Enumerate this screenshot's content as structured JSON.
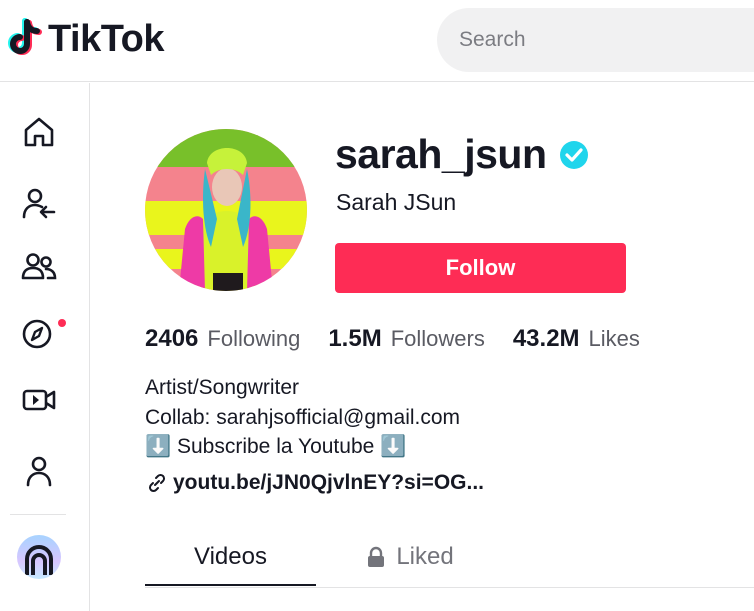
{
  "header": {
    "logo_text": "TikTok",
    "search_placeholder": "Search"
  },
  "sidebar": {
    "items": [
      {
        "name": "home",
        "icon": "home-icon"
      },
      {
        "name": "following",
        "icon": "user-follow-icon"
      },
      {
        "name": "friends",
        "icon": "friends-icon"
      },
      {
        "name": "explore",
        "icon": "compass-icon",
        "has_notification_dot": true
      },
      {
        "name": "live",
        "icon": "live-video-icon"
      },
      {
        "name": "profile",
        "icon": "profile-icon"
      }
    ]
  },
  "profile": {
    "username": "sarah_jsun",
    "nickname": "Sarah JSun",
    "verified": true,
    "follow_label": "Follow",
    "stats": [
      {
        "value": "2406",
        "label": "Following"
      },
      {
        "value": "1.5M",
        "label": "Followers"
      },
      {
        "value": "43.2M",
        "label": "Likes"
      }
    ],
    "bio": [
      "Artist/Songwriter",
      "Collab: sarahjsofficial@gmail.com",
      "⬇️ Subscribe la Youtube ⬇️"
    ],
    "link": "youtu.be/jJN0QjvlnEY?si=OG..."
  },
  "tabs": [
    {
      "label": "Videos",
      "active": true
    },
    {
      "label": "Liked",
      "active": false,
      "locked": true
    }
  ],
  "colors": {
    "accent": "#fe2c55",
    "verified": "#20d5ec",
    "text": "#161823",
    "muted": "#73747b"
  }
}
